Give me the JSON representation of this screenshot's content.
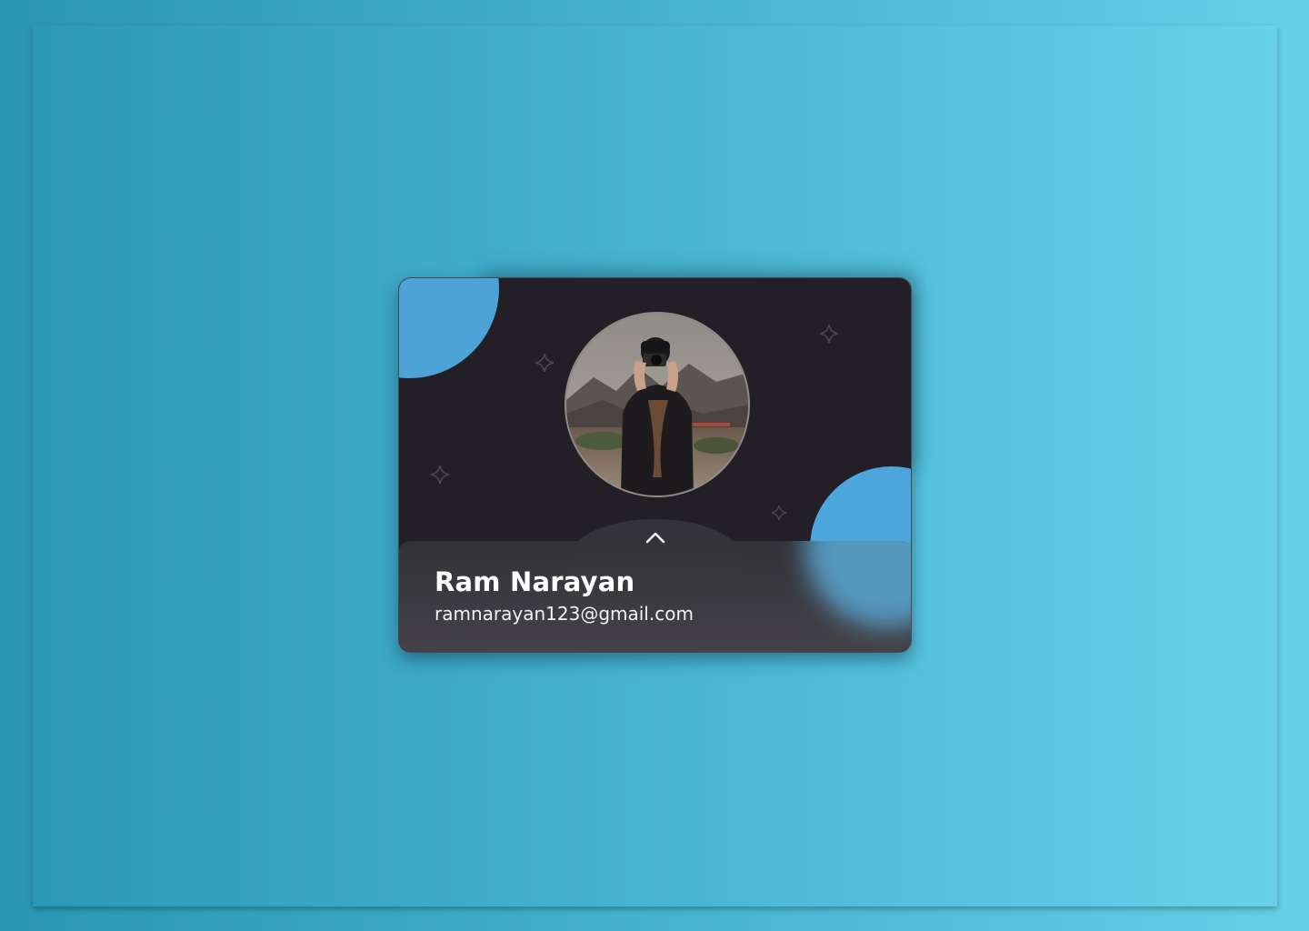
{
  "profile": {
    "name": "Ram Narayan",
    "email": "ramnarayan123@gmail.com"
  },
  "icons": {
    "expand": "chevron-up-icon",
    "decor": "sparkle-icon"
  },
  "colors": {
    "background_start": "#2a96b5",
    "background_end": "#66d0e8",
    "card": "#221f27",
    "accent_blob": "#4da2d6",
    "text": "#ffffff"
  }
}
